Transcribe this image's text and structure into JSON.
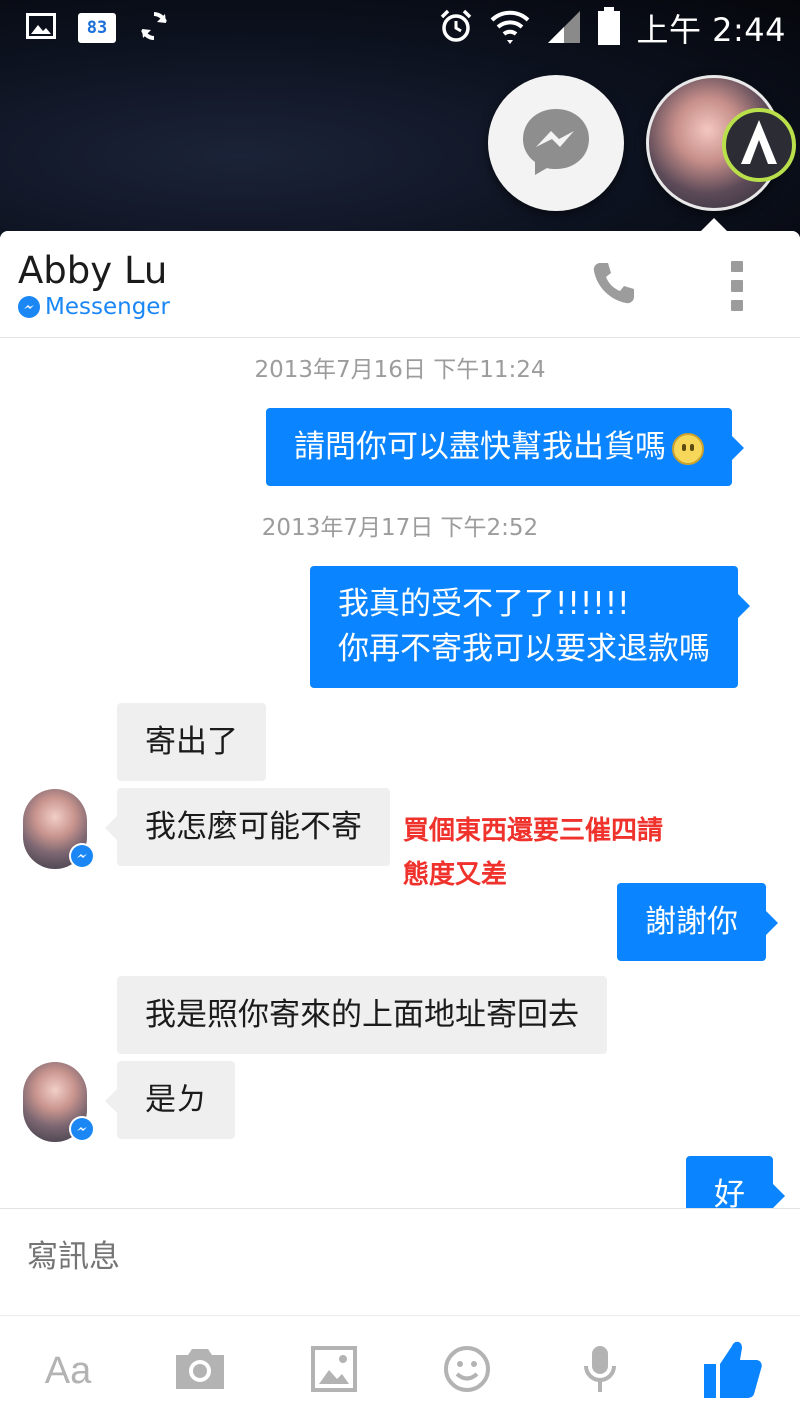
{
  "status_bar": {
    "badge_number": "83",
    "time": "上午 2:44"
  },
  "chat_header": {
    "contact_name": "Abby Lu",
    "source_label": "Messenger"
  },
  "messages": [
    {
      "type": "timestamp",
      "text": "2013年7月16日 下午11:24"
    },
    {
      "type": "outgoing",
      "text": "請問你可以盡快幫我出貨嗎",
      "emoji": "slightly-frowning-face"
    },
    {
      "type": "timestamp",
      "text": "2013年7月17日 下午2:52"
    },
    {
      "type": "outgoing",
      "lines": [
        "我真的受不了了!!!!!!",
        "你再不寄我可以要求退款嗎"
      ]
    },
    {
      "type": "incoming",
      "text": "寄出了"
    },
    {
      "type": "incoming",
      "text": "我怎麼可能不寄"
    },
    {
      "type": "outgoing",
      "text": "謝謝你"
    },
    {
      "type": "incoming",
      "text": "我是照你寄來的上面地址寄回去"
    },
    {
      "type": "incoming",
      "text": "是ㄉ"
    },
    {
      "type": "outgoing",
      "text": "好"
    }
  ],
  "annotation": {
    "lines": [
      "買個東西還要三催四請",
      "態度又差"
    ],
    "color": "#f0322d"
  },
  "composer": {
    "placeholder": "寫訊息"
  },
  "toolbar": {
    "text_button_label": "Aa",
    "items": [
      "text-format",
      "camera",
      "gallery",
      "emoji",
      "microphone",
      "like"
    ]
  },
  "colors": {
    "outgoing_bubble": "#0a84ff",
    "incoming_bubble": "#efefef",
    "accent": "#1a87f5"
  }
}
